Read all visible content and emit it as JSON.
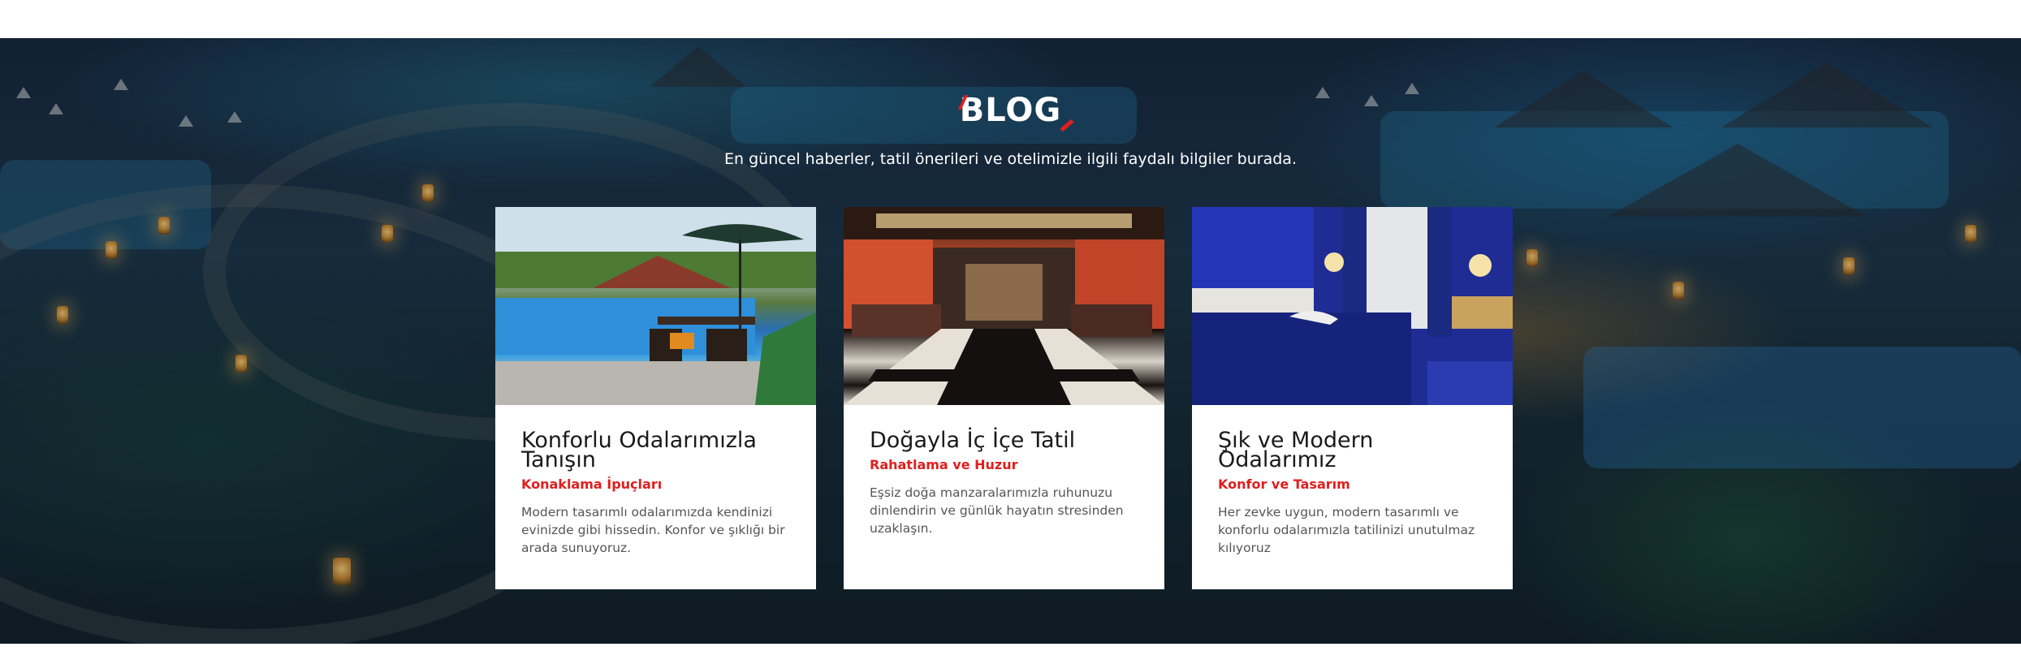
{
  "blog": {
    "title": "BLOG",
    "subtitle": "En güncel haberler, tatil önerileri ve otelimizle ilgili faydalı bilgiler burada.",
    "accent_color": "#e01e1e",
    "cards": [
      {
        "title": "Konforlu Odalarımızla Tanışın",
        "category": "Konaklama İpuçları",
        "text": "Modern tasarımlı odalarımızda kendinizi evinizde gibi hissedin. Konfor ve şıklığı bir arada sunuyoruz.",
        "image": "pool-terrace-photo"
      },
      {
        "title": "Doğayla İç İçe Tatil",
        "category": "Rahatlama ve Huzur",
        "text": "Eşsiz doğa manzaralarımızla ruhunuzu dinlendirin ve günlük hayatın stresinden uzaklaşın.",
        "image": "hotel-lobby-photo"
      },
      {
        "title": "Şık ve Modern Odalarımız",
        "category": "Konfor ve Tasarım",
        "text": "Her zevke uygun, modern tasarımlı ve konforlu odalarımızla tatilinizi unutulmaz kılıyoruz",
        "image": "blue-bedroom-photo"
      }
    ]
  }
}
